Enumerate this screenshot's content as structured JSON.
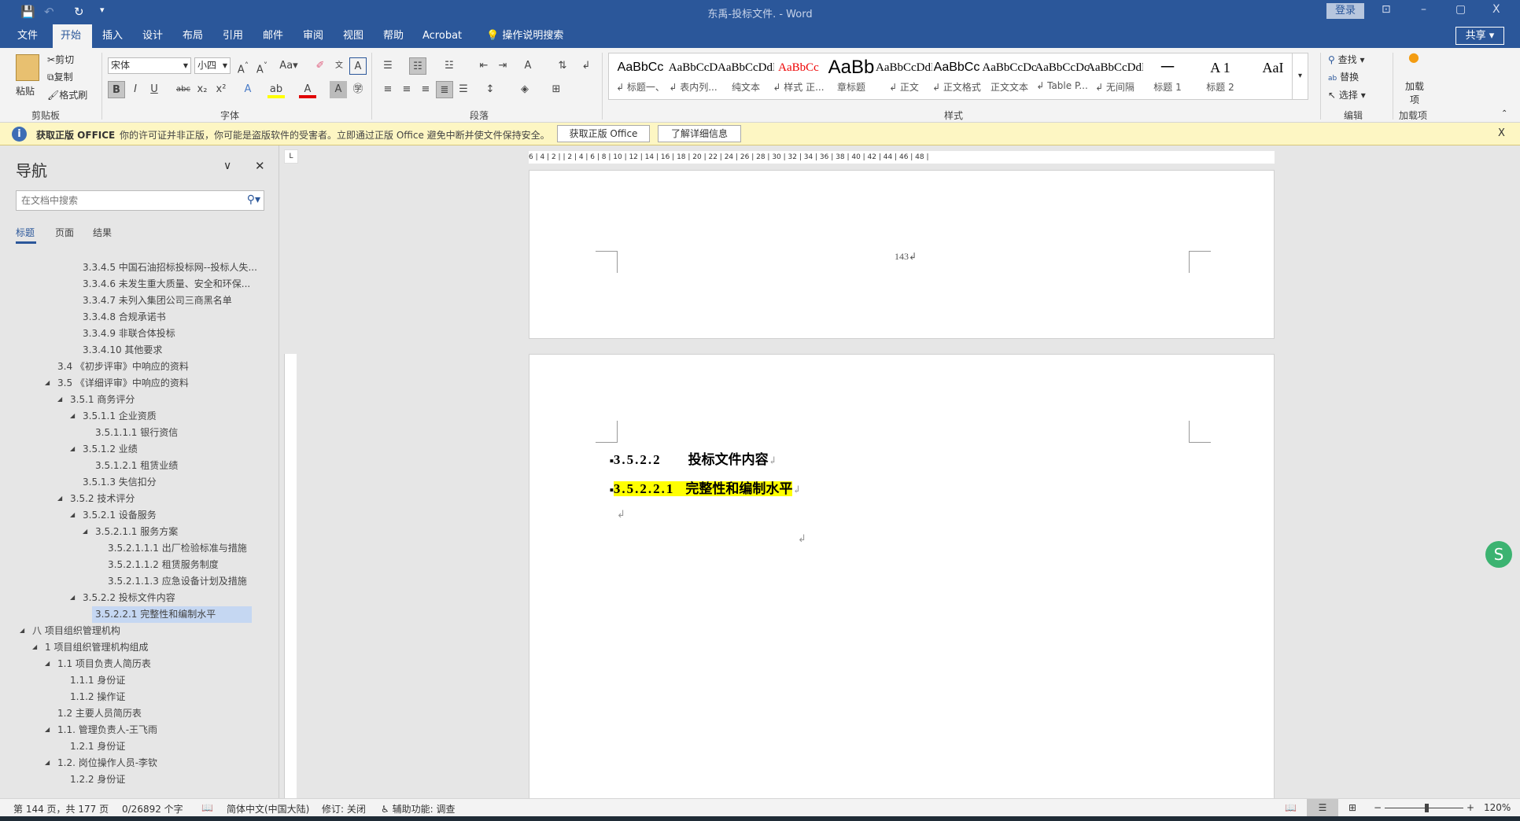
{
  "titlebar": {
    "title": "东禹-投标文件. - Word",
    "login": "登录",
    "minimize": "–",
    "restore": "▢",
    "close": "X",
    "ribbon_display": "⊡",
    "save_icon": "💾",
    "undo_icon": "↶",
    "redo_icon": "↻",
    "customize": "▾"
  },
  "tabs": [
    "文件",
    "开始",
    "插入",
    "设计",
    "布局",
    "引用",
    "邮件",
    "审阅",
    "视图",
    "帮助",
    "Acrobat"
  ],
  "tell_me": "操作说明搜索",
  "share": "共享",
  "ribbon": {
    "clipboard": {
      "paste": "粘贴",
      "cut": "剪切",
      "copy": "复制",
      "format_painter": "格式刷",
      "label": "剪贴板"
    },
    "font": {
      "name": "宋体",
      "size": "小四",
      "label": "字体"
    },
    "paragraph": {
      "label": "段落"
    },
    "styles": {
      "label": "样式",
      "items": [
        {
          "preview": "AaBbCc",
          "name": "↲ 标题一、"
        },
        {
          "preview": "AaBbCcD",
          "name": "↲ 表内列..."
        },
        {
          "preview": "AaBbCcDdI",
          "name": "纯文本"
        },
        {
          "preview": "AaBbCc",
          "name": "↲ 样式 正..."
        },
        {
          "preview": "AaBb",
          "name": "章标题"
        },
        {
          "preview": "AaBbCcDdI",
          "name": "↲ 正文"
        },
        {
          "preview": "AaBbCc",
          "name": "↲ 正文格式"
        },
        {
          "preview": "AaBbCcDc",
          "name": "正文文本"
        },
        {
          "preview": "AaBbCcDc",
          "name": "↲ Table P..."
        },
        {
          "preview": "AaBbCcDdI",
          "name": "↲ 无间隔"
        },
        {
          "preview": "一",
          "name": "标题 1"
        },
        {
          "preview": "A 1",
          "name": "标题 2"
        },
        {
          "preview": "AaI",
          "name": ""
        }
      ]
    },
    "editing": {
      "find": "查找",
      "replace": "替换",
      "select": "选择",
      "label": "编辑"
    },
    "addins": {
      "button": "加载项",
      "label": "加载项"
    }
  },
  "message_bar": {
    "title": "获取正版 OFFICE",
    "text": "你的许可证并非正版，你可能是盗版软件的受害者。立即通过正版 Office 避免中断并使文件保持安全。",
    "btn_genuine": "获取正版 Office",
    "btn_learn": "了解详细信息",
    "close": "X"
  },
  "nav": {
    "title": "导航",
    "search_placeholder": "在文档中搜索",
    "tabs": [
      "标题",
      "页面",
      "结果"
    ],
    "items": [
      {
        "text": "3.3.4.5 中国石油招标投标网--投标人失...",
        "level": 5,
        "exp": false
      },
      {
        "text": "3.3.4.6 未发生重大质量、安全和环保...",
        "level": 5,
        "exp": false
      },
      {
        "text": "3.3.4.7 未列入集团公司三商黑名单",
        "level": 5,
        "exp": false
      },
      {
        "text": "3.3.4.8 合规承诺书",
        "level": 5,
        "exp": false
      },
      {
        "text": "3.3.4.9 非联合体投标",
        "level": 5,
        "exp": false
      },
      {
        "text": "3.3.4.10 其他要求",
        "level": 5,
        "exp": false
      },
      {
        "text": "3.4 《初步评审》中响应的资料",
        "level": 3,
        "exp": false
      },
      {
        "text": "3.5 《详细评审》中响应的资料",
        "level": 3,
        "exp": true
      },
      {
        "text": "3.5.1 商务评分",
        "level": 4,
        "exp": true
      },
      {
        "text": "3.5.1.1 企业资质",
        "level": 5,
        "exp": true
      },
      {
        "text": "3.5.1.1.1 银行资信",
        "level": 6,
        "exp": false
      },
      {
        "text": "3.5.1.2 业绩",
        "level": 5,
        "exp": true
      },
      {
        "text": "3.5.1.2.1 租赁业绩",
        "level": 6,
        "exp": false
      },
      {
        "text": "3.5.1.3 失信扣分",
        "level": 5,
        "exp": false
      },
      {
        "text": "3.5.2 技术评分",
        "level": 4,
        "exp": true
      },
      {
        "text": "3.5.2.1 设备服务",
        "level": 5,
        "exp": true
      },
      {
        "text": "3.5.2.1.1 服务方案",
        "level": 6,
        "exp": true
      },
      {
        "text": "3.5.2.1.1.1 出厂检验标准与措施",
        "level": 7,
        "exp": false
      },
      {
        "text": "3.5.2.1.1.2 租赁服务制度",
        "level": 7,
        "exp": false
      },
      {
        "text": "3.5.2.1.1.3 应急设备计划及措施",
        "level": 7,
        "exp": false
      },
      {
        "text": "3.5.2.2 投标文件内容",
        "level": 5,
        "exp": true
      },
      {
        "text": "3.5.2.2.1 完整性和编制水平",
        "level": 6,
        "exp": false,
        "selected": true
      },
      {
        "text": "八 项目组织管理机构",
        "level": 1,
        "exp": true
      },
      {
        "text": "1 项目组织管理机构组成",
        "level": 2,
        "exp": true
      },
      {
        "text": "1.1 项目负责人简历表",
        "level": 3,
        "exp": true
      },
      {
        "text": "1.1.1 身份证",
        "level": 4,
        "exp": false
      },
      {
        "text": "1.1.2 操作证",
        "level": 4,
        "exp": false
      },
      {
        "text": "1.2 主要人员简历表",
        "level": 3,
        "exp": false
      },
      {
        "text": "1.1. 管理负责人-王飞雨",
        "level": 3,
        "exp": true
      },
      {
        "text": "1.2.1 身份证",
        "level": 4,
        "exp": false
      },
      {
        "text": "1.2. 岗位操作人员-李钦",
        "level": 3,
        "exp": true
      },
      {
        "text": "1.2.2 身份证",
        "level": 4,
        "exp": false
      }
    ]
  },
  "ruler": {
    "text": "6 | 4 | 2 | | 2 | 4 | 6 | 8 | 10 | 12 | 14 | 16 | 18 | 20 | 22 | 24 | 26 | 28 | 30 | 32 | 34 | 36 | 38 | 40 | 42 | 44 | 46 | 48 |"
  },
  "document": {
    "page_number": "143↲",
    "heading1_num": "3.5.2.2",
    "heading1_text": "投标文件内容",
    "heading2_num": "3.5.2.2.1",
    "heading2_text": "完整性和编制水平",
    "para_mark": "↲",
    "highlight": "#ffff00"
  },
  "status": {
    "page": "第 144 页，共 177 页",
    "words": "0/26892 个字",
    "language": "简体中文(中国大陆)",
    "track": "修订: 关闭",
    "accessibility": "辅助功能: 调查",
    "zoom": "120%",
    "zoom_value": 120
  },
  "colors": {
    "brand": "#2b579a",
    "message_bg": "#fdf6c3",
    "selected_nav": "#c5d7f2"
  }
}
